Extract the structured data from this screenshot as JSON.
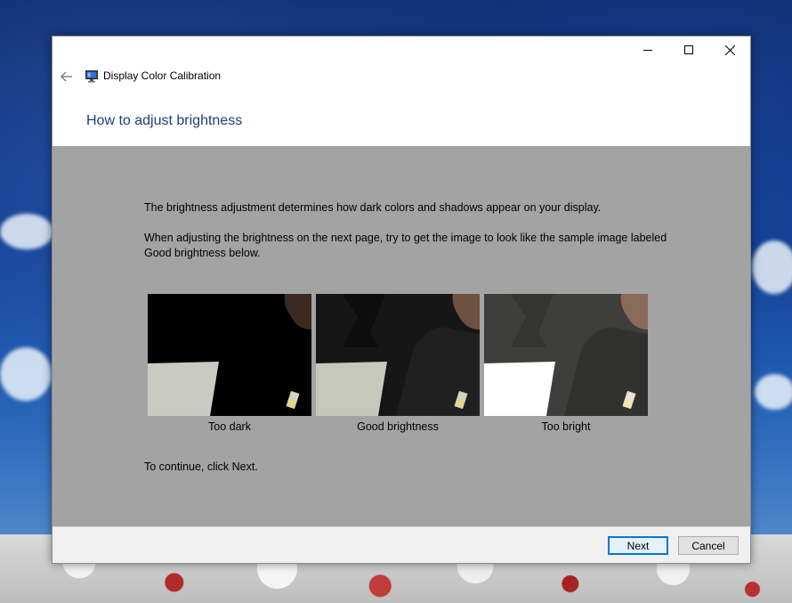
{
  "window": {
    "app_title": "Display Color Calibration",
    "page_heading": "How to adjust brightness"
  },
  "content": {
    "paragraph1": "The brightness adjustment determines how dark colors and shadows appear on your display.",
    "paragraph2": "When adjusting the brightness on the next page, try to get the image to look like the sample image labeled Good brightness below.",
    "continue_text": "To continue, click Next.",
    "samples": [
      {
        "label": "Too dark"
      },
      {
        "label": "Good brightness"
      },
      {
        "label": "Too bright"
      }
    ]
  },
  "footer": {
    "next_label": "Next",
    "cancel_label": "Cancel"
  },
  "colors": {
    "content_bg": "#a3a3a3",
    "heading": "#1f3d7a",
    "default_button_border": "#0078d7"
  }
}
